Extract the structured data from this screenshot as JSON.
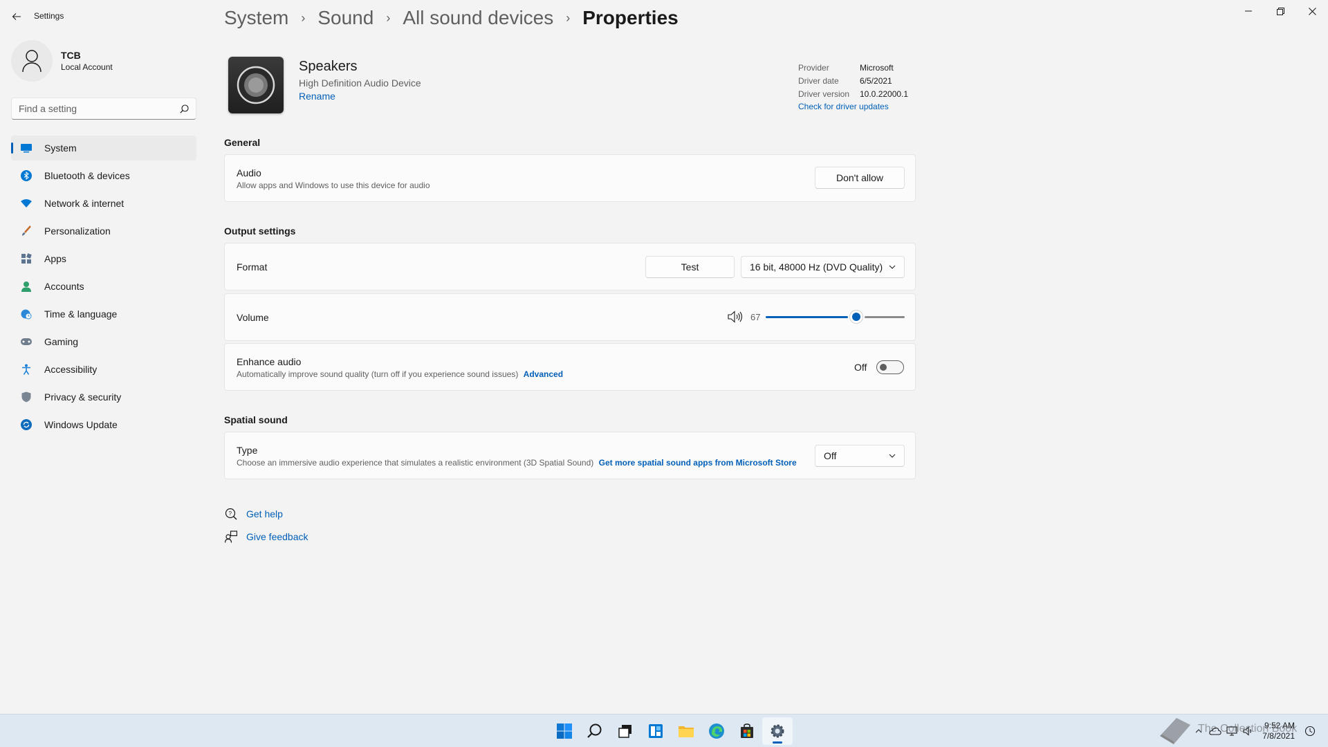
{
  "window": {
    "title": "Settings",
    "controls": [
      "minimize",
      "restore",
      "close"
    ]
  },
  "profile": {
    "name": "TCB",
    "account_type": "Local Account"
  },
  "search": {
    "placeholder": "Find a setting"
  },
  "sidebar": {
    "items": [
      {
        "label": "System",
        "icon": "system-icon",
        "active": true
      },
      {
        "label": "Bluetooth & devices",
        "icon": "bluetooth-icon"
      },
      {
        "label": "Network & internet",
        "icon": "wifi-icon"
      },
      {
        "label": "Personalization",
        "icon": "brush-icon"
      },
      {
        "label": "Apps",
        "icon": "apps-icon"
      },
      {
        "label": "Accounts",
        "icon": "person-icon"
      },
      {
        "label": "Time & language",
        "icon": "globe-clock-icon"
      },
      {
        "label": "Gaming",
        "icon": "gamepad-icon"
      },
      {
        "label": "Accessibility",
        "icon": "accessibility-icon"
      },
      {
        "label": "Privacy & security",
        "icon": "shield-icon"
      },
      {
        "label": "Windows Update",
        "icon": "update-icon"
      }
    ]
  },
  "breadcrumb": [
    "System",
    "Sound",
    "All sound devices",
    "Properties"
  ],
  "device": {
    "name": "Speakers",
    "subtitle": "High Definition Audio Device",
    "rename": "Rename",
    "driver": {
      "provider_label": "Provider",
      "provider": "Microsoft",
      "date_label": "Driver date",
      "date": "6/5/2021",
      "version_label": "Driver version",
      "version": "10.0.22000.1",
      "update_link": "Check for driver updates"
    }
  },
  "general": {
    "title": "General",
    "audio": {
      "title": "Audio",
      "description": "Allow apps and Windows to use this device for audio",
      "button": "Don't allow"
    }
  },
  "output": {
    "title": "Output settings",
    "format": {
      "title": "Format",
      "test_button": "Test",
      "selected": "16 bit, 48000 Hz (DVD Quality)"
    },
    "volume": {
      "title": "Volume",
      "value": "67",
      "level": 0.67
    },
    "enhance": {
      "title": "Enhance audio",
      "description": "Automatically improve sound quality (turn off if you experience sound issues)",
      "advanced_link": "Advanced",
      "state": "Off"
    }
  },
  "spatial": {
    "title": "Spatial sound",
    "type": {
      "title": "Type",
      "description": "Choose an immersive audio experience that simulates a realistic environment (3D Spatial Sound)",
      "store_link": "Get more spatial sound apps from Microsoft Store",
      "selected": "Off"
    }
  },
  "help": {
    "get_help": "Get help",
    "give_feedback": "Give feedback"
  },
  "taskbar": {
    "apps": [
      "start-icon",
      "search-icon",
      "task-view-icon",
      "widgets-icon",
      "file-explorer-icon",
      "edge-icon",
      "store-icon",
      "settings-icon"
    ],
    "time": "9:52 AM",
    "date": "7/8/2021",
    "watermark_text": "The Collection Book"
  },
  "colors": {
    "accent": "#005fb8",
    "background": "#f3f3f3",
    "card": "#fbfbfb"
  }
}
